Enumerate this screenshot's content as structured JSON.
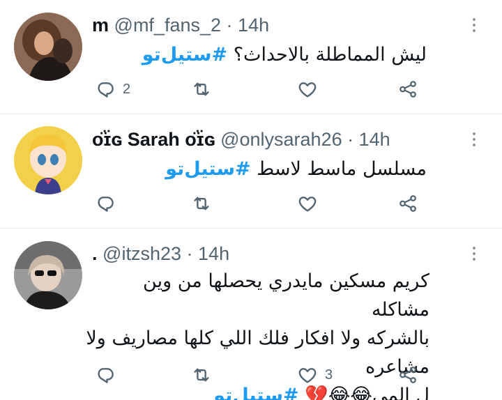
{
  "tweets": [
    {
      "name": "m",
      "handle": "@mf_fans_2",
      "separator": "·",
      "time": "14h",
      "lines": [
        "ليش المماطلة بالاحداث؟"
      ],
      "hashtag": "#ستيل‌تو",
      "replies": "2",
      "likes": "",
      "avatar_colors": [
        "#6b4a36",
        "#c8936e",
        "#2a1c15"
      ]
    },
    {
      "name": "ᴏ̈ɪ̈ɢ Sarah ᴏ̈ɪ̈ɢ",
      "handle": "@onlysarah26",
      "separator": "·",
      "time": "14h",
      "lines": [
        "مسلسل ماسط لاسط"
      ],
      "hashtag": "#ستيل‌تو",
      "replies": "",
      "likes": "",
      "avatar_colors": [
        "#f5d24a",
        "#7bb8d8",
        "#e98aa0"
      ]
    },
    {
      "name": ".",
      "handle": "@itzsh23",
      "separator": "·",
      "time": "14h",
      "lines": [
        "كريم مسكين مايدري يحصلها من وين مشاكله",
        "بالشركه ولا افكار فلك اللي كلها مصاريف ولا مشاعره",
        "ل المى😂😂💔"
      ],
      "hashtag": "#ستيل‌تو",
      "replies": "",
      "likes": "3",
      "avatar_colors": [
        "#3b3b3b",
        "#e0c7b3",
        "#1a1a1a"
      ]
    }
  ],
  "icons": {
    "reply": "reply-icon",
    "retweet": "retweet-icon",
    "like": "heart-icon",
    "share": "share-icon",
    "more": "more-options-icon"
  },
  "colors": {
    "hashtag": "#1d9bf0",
    "secondary_text": "#536471",
    "icon": "#536471",
    "divider": "#e6ecf0"
  }
}
